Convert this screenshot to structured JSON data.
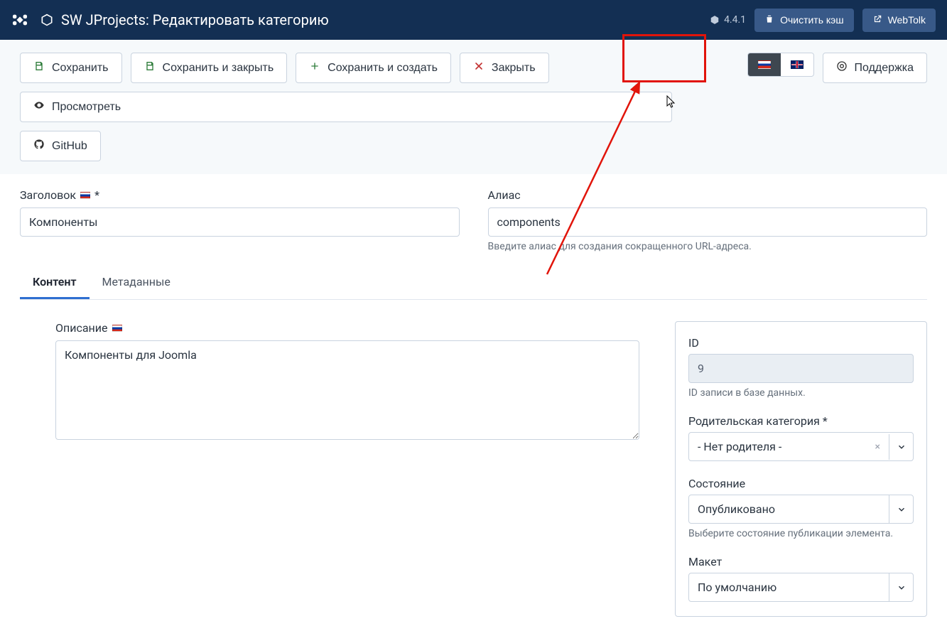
{
  "header": {
    "title": "SW JProjects: Редактировать категорию",
    "version": "4.4.1",
    "clear_cache": "Очистить кэш",
    "webtolk": "WebTolk"
  },
  "toolbar": {
    "save": "Сохранить",
    "save_close": "Сохранить и закрыть",
    "save_new": "Сохранить и создать",
    "close": "Закрыть",
    "preview": "Просмотреть",
    "support": "Поддержка",
    "github": "GitHub"
  },
  "form": {
    "title_label": "Заголовок",
    "title_value": "Компоненты",
    "alias_label": "Алиас",
    "alias_value": "components",
    "alias_help": "Введите алиас для создания сокращенного URL-адреса."
  },
  "tabs": {
    "content": "Контент",
    "metadata": "Метаданные"
  },
  "content": {
    "desc_label": "Описание",
    "desc_value": "Компоненты для Joomla"
  },
  "aside": {
    "id_label": "ID",
    "id_value": "9",
    "id_help": "ID записи в базе данных.",
    "parent_label": "Родительская категория *",
    "parent_value": "- Нет родителя -",
    "state_label": "Состояние",
    "state_value": "Опубликовано",
    "state_help": "Выберите состояние публикации элемента.",
    "layout_label": "Макет",
    "layout_value": "По умолчанию"
  }
}
